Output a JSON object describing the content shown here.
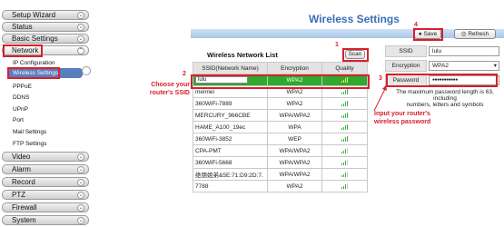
{
  "sidebar": {
    "menu": [
      {
        "label": "Setup Wizard"
      },
      {
        "label": "Status"
      },
      {
        "label": "Basic Settings"
      },
      {
        "label": "Network"
      },
      {
        "label": "Video"
      },
      {
        "label": "Alarm"
      },
      {
        "label": "Record"
      },
      {
        "label": "PTZ"
      },
      {
        "label": "Firewall"
      },
      {
        "label": "System"
      }
    ],
    "network_sub": [
      "IP Configuration",
      "Wireless Settings",
      "PPPoE",
      "DDNS",
      "UPnP",
      "Port",
      "Mail Settings",
      "FTP Settings"
    ]
  },
  "page": {
    "title": "Wireless Settings",
    "save_label": "Save",
    "refresh_label": "Refresh"
  },
  "wifi_list": {
    "title": "Wireless Network List",
    "scan_label": "Scan",
    "columns": [
      "SSID(Network Name)",
      "Encryption",
      "Quality"
    ],
    "rows": [
      {
        "ssid": "lulu",
        "encryption": "WPA2",
        "quality": 4
      },
      {
        "ssid": "meimei",
        "encryption": "WPA2",
        "quality": 4
      },
      {
        "ssid": "360WiFi-7889",
        "encryption": "WPA2",
        "quality": 4
      },
      {
        "ssid": "MERCURY_966CBE",
        "encryption": "WPA/WPA2",
        "quality": 4
      },
      {
        "ssid": "HAME_A100_19ec",
        "encryption": "WPA",
        "quality": 4
      },
      {
        "ssid": "360WiFi-3852",
        "encryption": "WEP",
        "quality": 4
      },
      {
        "ssid": "CPA-PMT",
        "encryption": "WPA/WPA2",
        "quality": 3
      },
      {
        "ssid": "360WiFi-5668",
        "encryption": "WPA/WPA2",
        "quality": 3
      },
      {
        "ssid": "绝朋姐弟&5E:71:D9:2D:7.",
        "encryption": "WPA/WPA2",
        "quality": 3
      },
      {
        "ssid": "7788",
        "encryption": "WPA2",
        "quality": 3
      }
    ]
  },
  "form": {
    "ssid_label": "SSID",
    "ssid_value": "lulu",
    "encryption_label": "Encryption",
    "encryption_value": "WPA2",
    "password_label": "Password",
    "password_value": "●●●●●●●●●●●",
    "note_line1": "The maximum password length is 63, including",
    "note_line2": "numbers, letters and symbols"
  },
  "annotations": {
    "n1": "1",
    "n2": "2",
    "n3": "3",
    "n4": "4",
    "choose_line1": "Choose your",
    "choose_line2": "router's SSID",
    "input_line1": "Input your router's",
    "input_line2": "wireless password"
  },
  "colors": {
    "accent": "#3a6fb8",
    "annotation_red": "#d8202a",
    "selected_row_green": "#2eaa2e",
    "selected_menu_blue": "#5a7dbf"
  }
}
